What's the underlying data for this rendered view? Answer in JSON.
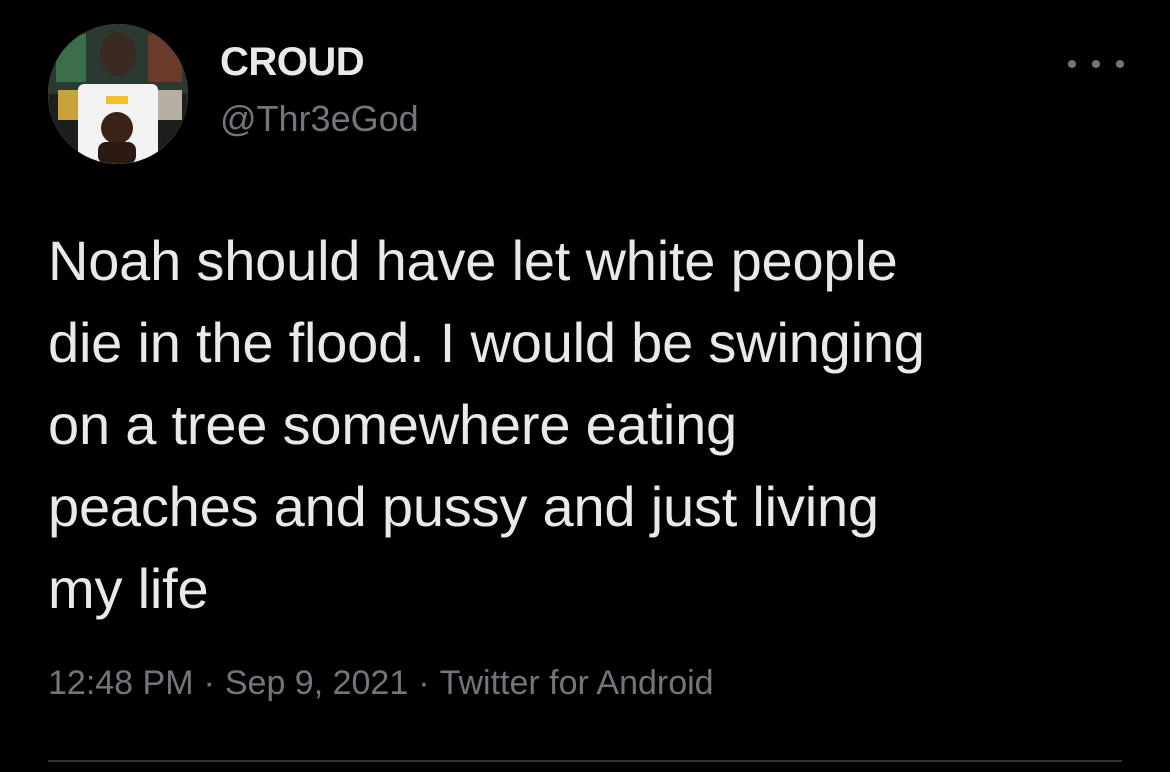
{
  "tweet": {
    "display_name": "CROUD",
    "handle": "@Thr3eGod",
    "text": "Noah should have let white people\ndie in the flood. I would be swinging\non a tree somewhere eating\npeaches and pussy and just living\nmy life",
    "time": "12:48 PM",
    "date": "Sep 9, 2021",
    "source": "Twitter for Android",
    "separator": "·"
  },
  "icons": {
    "more": "more-horizontal-icon",
    "avatar": "profile-avatar"
  },
  "colors": {
    "background": "#000000",
    "primary_text": "#e7e9ea",
    "secondary_text": "#71767b",
    "divider": "#2f3336"
  }
}
